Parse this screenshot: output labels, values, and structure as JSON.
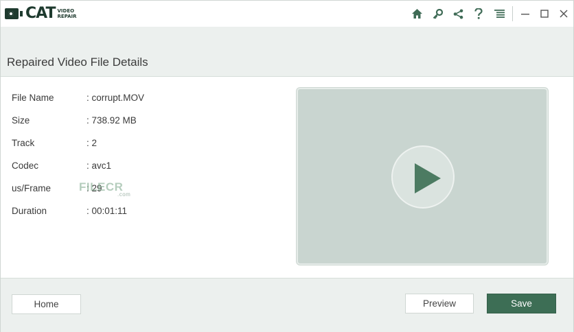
{
  "app": {
    "logo_main": "CAT",
    "logo_sub_line1": "VIDEO",
    "logo_sub_line2": "REPAIR"
  },
  "toolbar": {
    "icons": [
      "home-icon",
      "key-icon",
      "share-icon",
      "help-icon",
      "menu-icon"
    ],
    "window_controls": [
      "minimize-icon",
      "maximize-icon",
      "close-icon"
    ]
  },
  "page": {
    "title": "Repaired Video File Details"
  },
  "details": [
    {
      "label": "File Name",
      "value": ": corrupt.MOV"
    },
    {
      "label": "Size",
      "value": ": 738.92 MB"
    },
    {
      "label": "Track",
      "value": ": 2"
    },
    {
      "label": "Codec",
      "value": ": avc1"
    },
    {
      "label": "us/Frame",
      "value": ": 29"
    },
    {
      "label": "Duration",
      "value": ": 00:01:11"
    }
  ],
  "watermark": {
    "text": "FILECR",
    "sub": ".com"
  },
  "footer": {
    "home_label": "Home",
    "preview_label": "Preview",
    "save_label": "Save"
  },
  "colors": {
    "brand": "#1e3a2e",
    "accent": "#3d6e55",
    "header_bg": "#ecf0ee",
    "preview_bg": "#c9d5d0"
  }
}
